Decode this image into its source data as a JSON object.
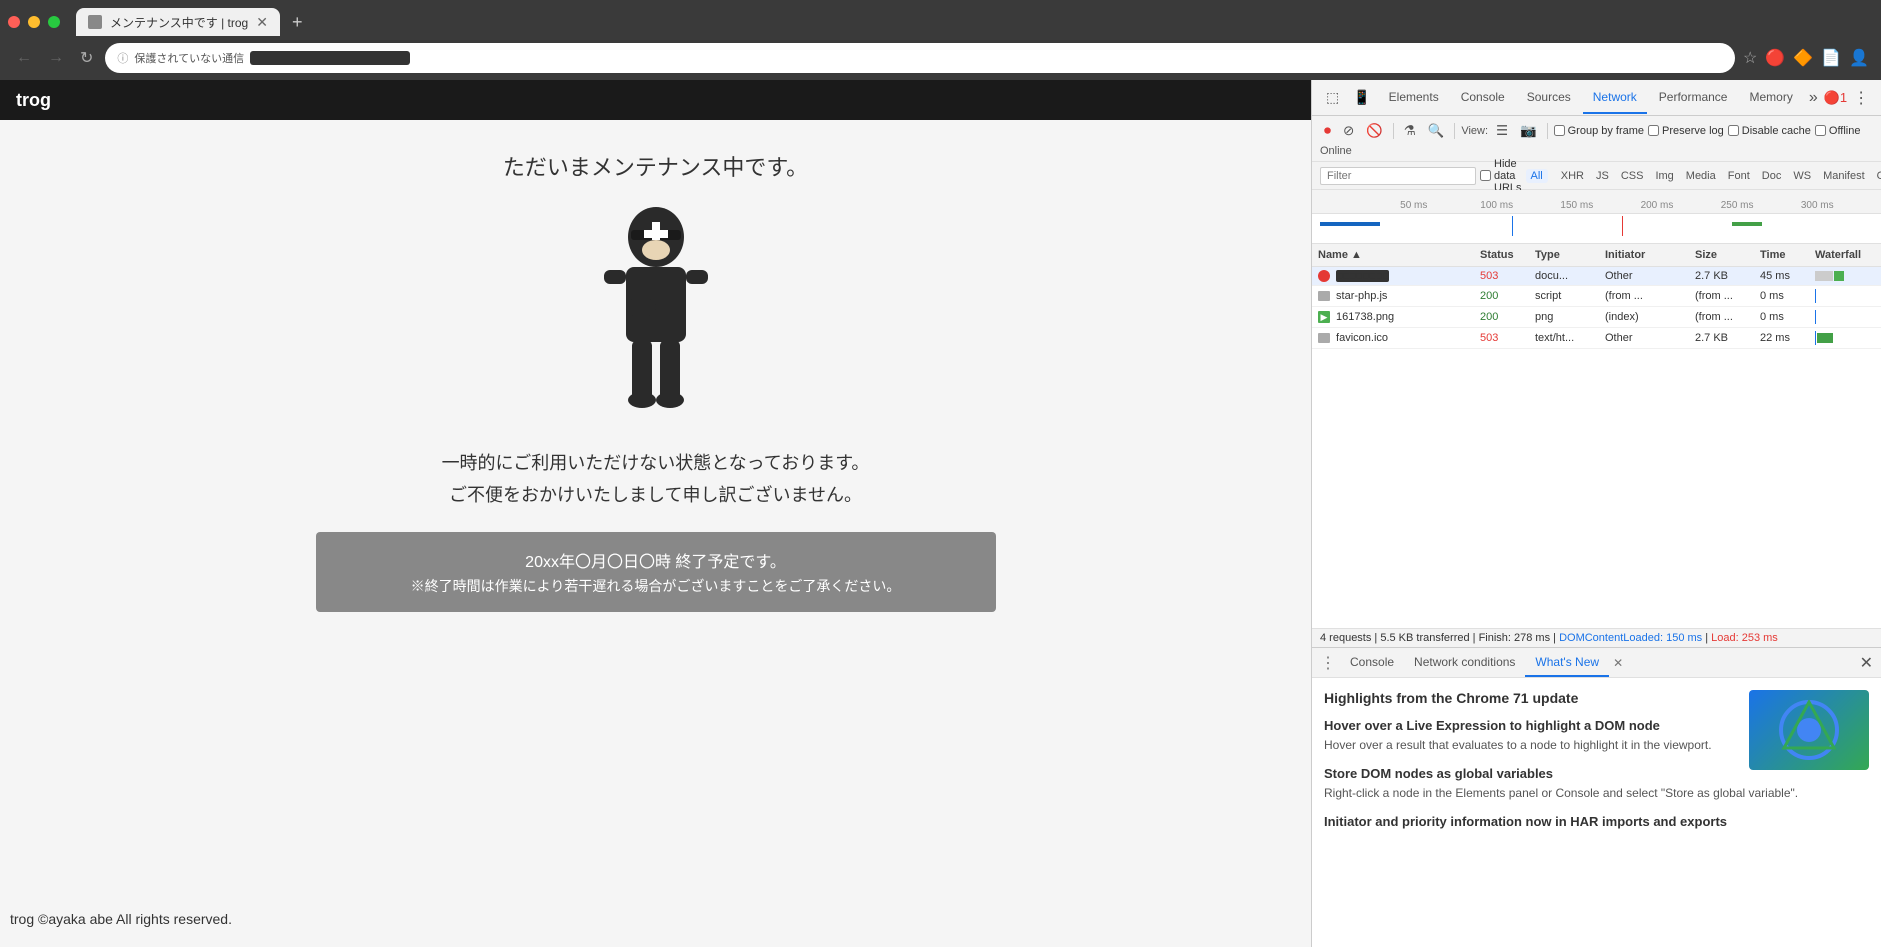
{
  "browser": {
    "tab_title": "メンテナンス中です | trog",
    "address_bar": {
      "security_label": "保護されていない通信",
      "url_placeholder": ""
    },
    "nav": {
      "back": "←",
      "forward": "→",
      "reload": "↻"
    }
  },
  "page": {
    "site_title": "trog",
    "maintenance_heading": "ただいまメンテナンス中です。",
    "sub_text_line1": "一時的にご利用いただけない状態となっております。",
    "sub_text_line2": "ご不便をおかけいたしまして申し訳ございません。",
    "box_line1": "20xx年〇月〇日〇時 終了予定です。",
    "box_line2": "※終了時間は作業により若干遅れる場合がございますことをご了承ください。",
    "footer": "trog ©ayaka abe All rights reserved."
  },
  "devtools": {
    "tabs": [
      {
        "label": "Elements",
        "active": false
      },
      {
        "label": "Console",
        "active": false
      },
      {
        "label": "Sources",
        "active": false
      },
      {
        "label": "Network",
        "active": true
      },
      {
        "label": "Performance",
        "active": false
      },
      {
        "label": "Memory",
        "active": false
      }
    ],
    "network": {
      "toolbar": {
        "record_label": "●",
        "stop_label": "⊘",
        "clear_label": "🚫",
        "filter_label": "⚗",
        "search_label": "🔍",
        "view_label": "View:",
        "group_by_frame": "Group by frame",
        "preserve_log": "Preserve log",
        "disable_cache": "Disable cache",
        "offline": "Offline",
        "online_label": "Online"
      },
      "filter": {
        "placeholder": "Filter",
        "hide_data_urls": "Hide data URLs",
        "all_badge": "All",
        "types": [
          "XHR",
          "JS",
          "CSS",
          "Img",
          "Media",
          "Font",
          "Doc",
          "WS",
          "Manifest",
          "Other"
        ]
      },
      "timeline_marks": [
        "50 ms",
        "100 ms",
        "150 ms",
        "200 ms",
        "250 ms",
        "300 ms"
      ],
      "columns": [
        "Name",
        "Status",
        "Type",
        "Initiator",
        "Size",
        "Time",
        "Waterfall"
      ],
      "rows": [
        {
          "name": "■■■■■■■■",
          "status": "503",
          "type": "docu...",
          "initiator": "Other",
          "size": "2.7 KB",
          "time": "45 ms",
          "has_waterfall": true,
          "error": true,
          "selected": true
        },
        {
          "name": "star-php.js",
          "status": "200",
          "type": "script",
          "initiator": "(from ...",
          "size": "(from ...",
          "time": "0 ms",
          "has_waterfall": true,
          "error": false
        },
        {
          "name": "161738.png",
          "status": "200",
          "type": "png",
          "initiator": "(index)",
          "size": "(from ...",
          "time": "0 ms",
          "has_waterfall": true,
          "error": false
        },
        {
          "name": "favicon.ico",
          "status": "503",
          "type": "text/ht...",
          "initiator": "Other",
          "size": "2.7 KB",
          "time": "22 ms",
          "has_waterfall": true,
          "error": false
        }
      ],
      "status_bar": "4 requests | 5.5 KB transferred | Finish: 278 ms |",
      "domcontentloaded": "DOMContentLoaded: 150 ms",
      "load": "Load: 253 ms"
    },
    "bottom_panel": {
      "tabs": [
        {
          "label": "Console",
          "active": false
        },
        {
          "label": "Network conditions",
          "active": false
        },
        {
          "label": "What's New",
          "active": true
        }
      ],
      "whats_new": {
        "heading": "Highlights from the Chrome 71 update",
        "features": [
          {
            "title": "Hover over a Live Expression to highlight a DOM node",
            "description": "Hover over a result that evaluates to a node to highlight it in the viewport."
          },
          {
            "title": "Store DOM nodes as global variables",
            "description": "Right-click a node in the Elements panel or Console and select \"Store as global variable\"."
          },
          {
            "title": "Initiator and priority information now in HAR imports and exports",
            "description": ""
          }
        ]
      }
    }
  }
}
